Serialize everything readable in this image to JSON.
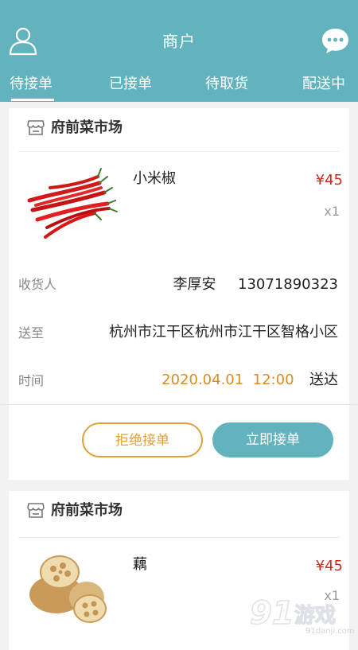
{
  "header": {
    "title": "商户",
    "tabs": [
      {
        "label": "待接单",
        "active": true
      },
      {
        "label": "已接单",
        "active": false
      },
      {
        "label": "待取货",
        "active": false
      },
      {
        "label": "配送中",
        "active": false
      }
    ],
    "left_icon": "user-icon",
    "right_icon": "chat-bubble-icon"
  },
  "orders": [
    {
      "shop_name": "府前菜市场",
      "shop_icon": "store-icon",
      "product": {
        "name": "小米椒",
        "price": "¥45",
        "qty": "x1",
        "image": "red-chili-peppers"
      },
      "receiver_label": "收货人",
      "receiver_name": "李厚安",
      "receiver_phone": "13071890323",
      "address_label": "送至",
      "address": "杭州市江干区杭州市江干区智格小区",
      "time_label": "时间",
      "time_value": "2020.04.01  12:00",
      "time_suffix": "送达",
      "reject_label": "拒绝接单",
      "accept_label": "立即接单"
    },
    {
      "shop_name": "府前菜市场",
      "shop_icon": "store-icon",
      "product": {
        "name": "藕",
        "price": "¥45",
        "qty": "x1",
        "image": "lotus-root"
      }
    }
  ],
  "watermark": {
    "text": "游戏",
    "sub": "91danji.com"
  },
  "colors": {
    "primary": "#62b3be",
    "price": "#cc2b1f",
    "time": "#e08a20",
    "reject_border": "#e0a03a"
  }
}
